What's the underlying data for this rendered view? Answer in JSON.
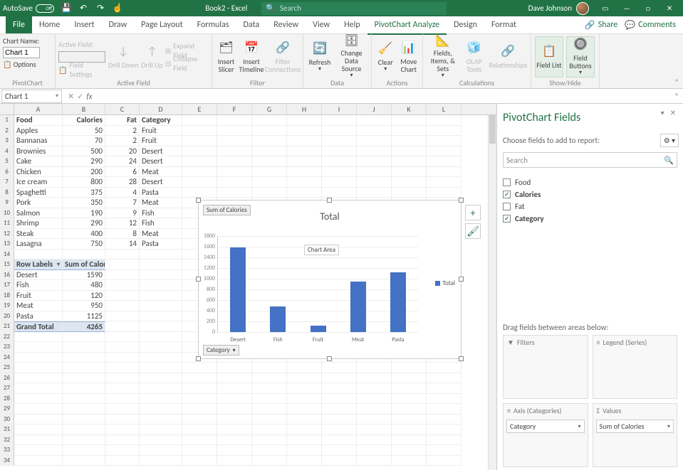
{
  "titlebar": {
    "autosave_label": "AutoSave",
    "autosave_state": "Off",
    "qat_save_icon": "💾",
    "qat_undo_icon": "↶",
    "qat_redo_icon": "↷",
    "qat_touch_icon": "☝",
    "doc_title": "Book2 - Excel",
    "search_placeholder": "Search",
    "user_name": "Dave Johnson",
    "ribbon_display": "▭",
    "min_icon": "—",
    "max_icon": "□",
    "close_icon": "✕"
  },
  "menus": {
    "tabs": [
      "File",
      "Home",
      "Insert",
      "Draw",
      "Page Layout",
      "Formulas",
      "Data",
      "Review",
      "View",
      "Help",
      "PivotChart Analyze",
      "Design",
      "Format"
    ],
    "active": 10,
    "share": "Share",
    "comments": "Comments"
  },
  "ribbon": {
    "group_pivotchart": "PivotChart",
    "chart_name_label": "Chart Name:",
    "chart_name_value": "Chart 1",
    "options_label": "Options",
    "group_activefield": "Active Field",
    "active_field_label": "Active Field:",
    "drill_down": "Drill Down",
    "drill_up": "Drill Up",
    "field_settings": "Field Settings",
    "expand_field": "Expand Field",
    "collapse_field": "Collapse Field",
    "group_filter": "Filter",
    "insert_slicer": "Insert Slicer",
    "insert_timeline": "Insert Timeline",
    "filter_conn": "Filter Connections",
    "group_data": "Data",
    "refresh": "Refresh",
    "change_data": "Change Data Source",
    "group_actions": "Actions",
    "clear": "Clear",
    "move_chart": "Move Chart",
    "group_calc": "Calculations",
    "fields_items_sets": "Fields, Items, & Sets",
    "olap_tools": "OLAP Tools",
    "relationships": "Relationships",
    "group_showhide": "Show/Hide",
    "field_list": "Field List",
    "field_buttons": "Field Buttons"
  },
  "namebox": {
    "value": "Chart 1",
    "fx": "fx"
  },
  "columns": [
    "A",
    "B",
    "C",
    "D",
    "E",
    "F",
    "G",
    "H",
    "I",
    "J",
    "K",
    "L"
  ],
  "food_headers": [
    "Food",
    "Calories",
    "Fat",
    "Category"
  ],
  "food_rows": [
    [
      "Apples",
      "50",
      "2",
      "Fruit"
    ],
    [
      "Bannanas",
      "70",
      "2",
      "Fruit"
    ],
    [
      "Brownies",
      "500",
      "20",
      "Desert"
    ],
    [
      "Cake",
      "290",
      "24",
      "Desert"
    ],
    [
      "Chicken",
      "200",
      "6",
      "Meat"
    ],
    [
      "Ice cream",
      "800",
      "28",
      "Desert"
    ],
    [
      "Spaghetti",
      "375",
      "4",
      "Pasta"
    ],
    [
      "Pork",
      "350",
      "7",
      "Meat"
    ],
    [
      "Salmon",
      "190",
      "9",
      "Fish"
    ],
    [
      "Shrimp",
      "290",
      "12",
      "Fish"
    ],
    [
      "Steak",
      "400",
      "8",
      "Meat"
    ],
    [
      "Lasagna",
      "750",
      "14",
      "Pasta"
    ]
  ],
  "pivot": {
    "row_labels_hdr": "Row Labels",
    "sum_hdr": "Sum of Calories",
    "rows": [
      [
        "Desert",
        "1590"
      ],
      [
        "Fish",
        "480"
      ],
      [
        "Fruit",
        "120"
      ],
      [
        "Meat",
        "950"
      ],
      [
        "Pasta",
        "1125"
      ]
    ],
    "grand_total_label": "Grand Total",
    "grand_total_value": "4265"
  },
  "chart": {
    "sum_btn": "Sum of Calories",
    "title": "Total",
    "tooltip": "Chart Area",
    "category_btn": "Category",
    "legend": "Total",
    "plus_icon": "+",
    "brush_icon": "🖌"
  },
  "chart_data": {
    "type": "bar",
    "title": "Total",
    "categories": [
      "Desert",
      "Fish",
      "Fruit",
      "Meat",
      "Pasta"
    ],
    "values": [
      1590,
      480,
      120,
      950,
      1125
    ],
    "series_name": "Total",
    "ylim": [
      0,
      1800
    ],
    "ytick_step": 200,
    "xlabel": "",
    "ylabel": ""
  },
  "pane": {
    "title": "PivotChart Fields",
    "choose_label": "Choose fields to add to report:",
    "gear": "⚙",
    "search_placeholder": "Search",
    "fields": [
      {
        "name": "Food",
        "checked": false
      },
      {
        "name": "Calories",
        "checked": true
      },
      {
        "name": "Fat",
        "checked": false
      },
      {
        "name": "Category",
        "checked": true
      }
    ],
    "drag_label": "Drag fields between areas below:",
    "filters_hdr": "Filters",
    "legend_hdr": "Legend (Series)",
    "axis_hdr": "Axis (Categories)",
    "values_hdr": "Values",
    "axis_item": "Category",
    "values_item": "Sum of Calories"
  }
}
